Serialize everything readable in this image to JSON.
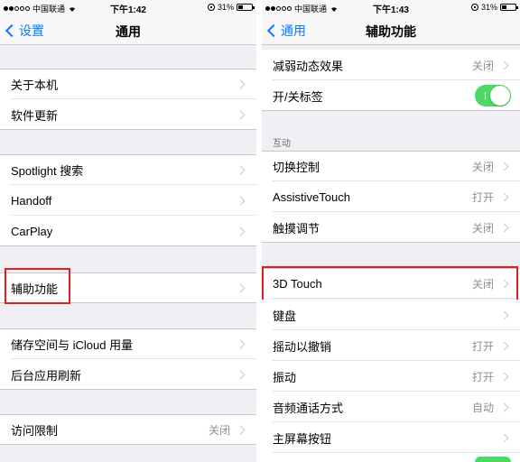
{
  "left": {
    "status": {
      "carrier": "中国联通",
      "time": "下午1:42",
      "battery": "31%"
    },
    "nav": {
      "back_label": "设置",
      "title": "通用"
    },
    "groups": [
      [
        "关于本机",
        "软件更新"
      ],
      [
        "Spotlight 搜索",
        "Handoff",
        "CarPlay"
      ],
      [
        "辅助功能"
      ],
      [
        "储存空间与 iCloud 用量",
        "后台应用刷新"
      ],
      [
        {
          "label": "访问限制",
          "value": "关闭"
        }
      ]
    ]
  },
  "right": {
    "status": {
      "carrier": "中国联通",
      "time": "下午1:43",
      "battery": "31%"
    },
    "nav": {
      "back_label": "通用",
      "title": "辅助功能"
    },
    "top_rows": [
      {
        "label": "减弱动态效果",
        "value": "关闭"
      },
      {
        "label": "开/关标签",
        "toggle": true
      }
    ],
    "interaction_header": "互动",
    "interaction_rows": [
      {
        "label": "切换控制",
        "value": "关闭"
      },
      {
        "label": "AssistiveTouch",
        "value": "打开"
      },
      {
        "label": "触摸调节",
        "value": "关闭"
      }
    ],
    "more_rows": [
      {
        "label": "3D Touch",
        "value": "关闭"
      },
      {
        "label": "键盘",
        "value": ""
      },
      {
        "label": "摇动以撤销",
        "value": "打开"
      },
      {
        "label": "振动",
        "value": "打开"
      },
      {
        "label": "音频通话方式",
        "value": "自动"
      },
      {
        "label": "主屏幕按钮",
        "value": ""
      }
    ]
  },
  "colors": {
    "accent": "#0a7aff",
    "toggle_on": "#4cd964",
    "highlight": "#e02020"
  }
}
